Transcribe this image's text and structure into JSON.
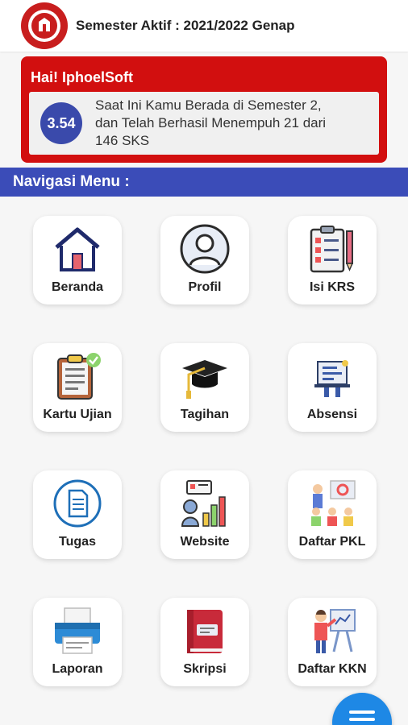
{
  "header": {
    "title": "Semester Aktif : 2021/2022 Genap",
    "logo_icon": "university-seal-icon"
  },
  "welcome": {
    "greeting": "Hai! IphoelSoft",
    "ipk": "3.54",
    "message_line1": "Saat Ini Kamu Berada di Semester 2,",
    "message_line2": "dan Telah Berhasil Menempuh 21 dari",
    "message_line3": "146 SKS"
  },
  "nav": {
    "title": "Navigasi Menu :"
  },
  "menu": [
    {
      "label": "Beranda",
      "icon": "home-icon"
    },
    {
      "label": "Profil",
      "icon": "user-profile-icon"
    },
    {
      "label": "Isi KRS",
      "icon": "clipboard-checklist-icon"
    },
    {
      "label": "Kartu Ujian",
      "icon": "exam-card-icon"
    },
    {
      "label": "Tagihan",
      "icon": "graduation-cap-icon"
    },
    {
      "label": "Absensi",
      "icon": "attendance-icon"
    },
    {
      "label": "Tugas",
      "icon": "document-icon"
    },
    {
      "label": "Website",
      "icon": "website-chart-icon"
    },
    {
      "label": "Daftar PKL",
      "icon": "presentation-icon"
    },
    {
      "label": "Laporan",
      "icon": "printer-icon"
    },
    {
      "label": "Skripsi",
      "icon": "book-icon"
    },
    {
      "label": "Daftar KKN",
      "icon": "teacher-board-icon"
    }
  ],
  "fab": {
    "icon": "menu-icon"
  },
  "colors": {
    "accent_red": "#d20f0f",
    "nav_blue": "#3b4cb8",
    "fab_blue": "#1e88e5"
  }
}
